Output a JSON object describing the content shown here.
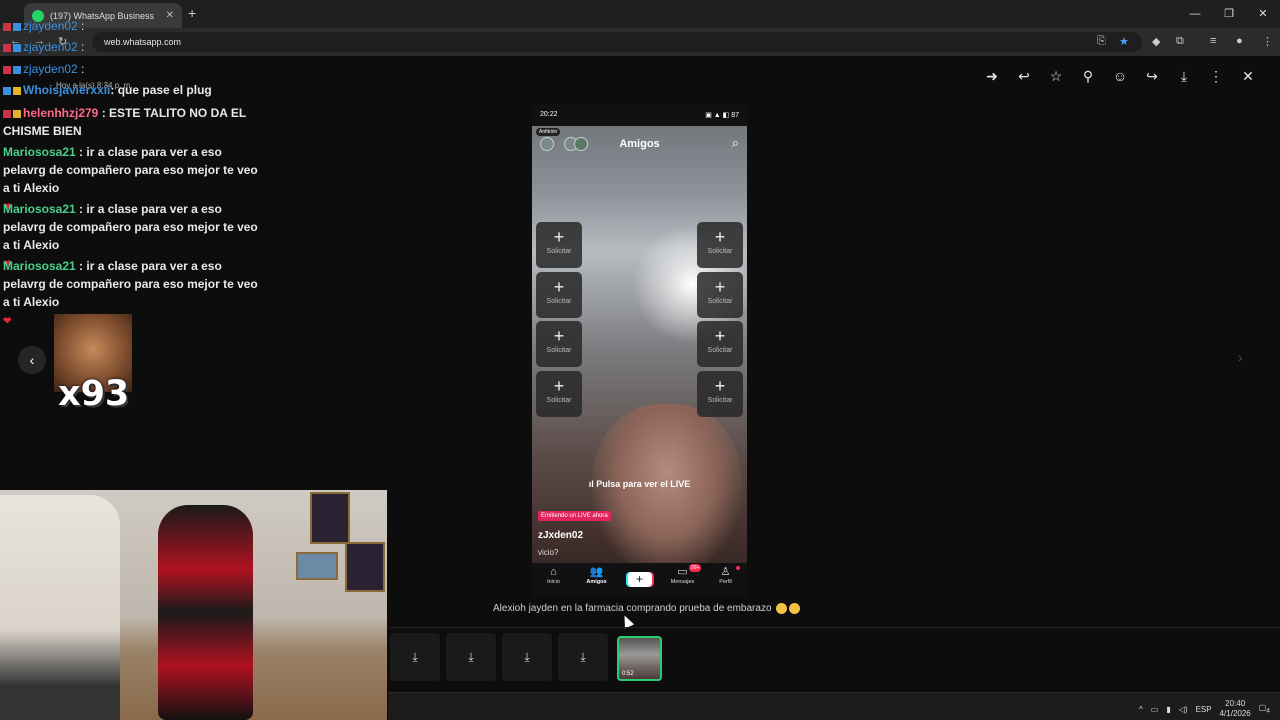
{
  "browser": {
    "tab_title": "(197) WhatsApp Business",
    "tab_close": "✕",
    "new_tab": "+",
    "url": "web.whatsapp.com",
    "window_controls": [
      "—",
      "❐",
      "✕"
    ]
  },
  "viewer": {
    "sender_time": "Hoy a la(s) 8:34 p. m.",
    "caption": "Alexioh jayden en la farmacia comprando prueba de embarazo",
    "top_icons": [
      "forward-icon",
      "reply-icon",
      "star-icon",
      "pin-icon",
      "emoji-icon",
      "share-icon",
      "download-icon",
      "more-icon",
      "close-icon"
    ]
  },
  "phone": {
    "status_time": "20:22",
    "status_right": "▣ ▲ ◧ 87",
    "host_label": "Anfitrión",
    "title": "Amigos",
    "slot_label": "Solicitar",
    "pulsa": "Pulsa para ver el LIVE",
    "live_badge": "Emitiendo un LIVE ahora",
    "username": "zJxden02",
    "caption": "vicio?",
    "nav": {
      "inicio": "Inicio",
      "amigos": "Amigos",
      "mensajes": "Mensajes",
      "perfil": "Perfil",
      "badge": "99+"
    }
  },
  "thumbs": {
    "active_duration": "0:52"
  },
  "chat": {
    "l1_user": "zjayden02",
    "l2_user": "zjayden02",
    "l3_user": "zjayden02",
    "l4_user": "Whoisjavierxxii",
    "l4_msg": ": que pase el plug",
    "l5_user": "helenhhzj279",
    "l5_msg": ": ESTE TALITO NO DA EL CHISME BIEN",
    "mario_user": "Mariososa21",
    "mario_msg": ": ir a clase para ver a eso pelavrg de compañero para eso mejor te veo a ti Alexio",
    "meme_text": "x93"
  },
  "taskbar": {
    "lang": "ESP",
    "time": "20:40",
    "date": "4/1/2026",
    "notif": "4"
  }
}
